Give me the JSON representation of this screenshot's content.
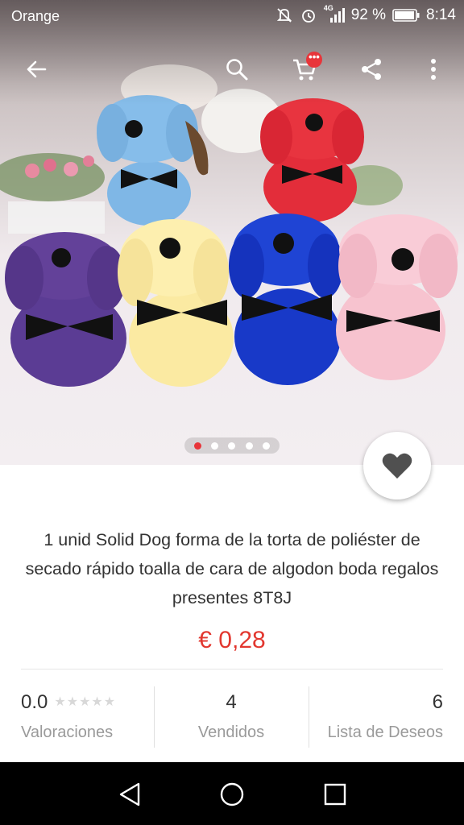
{
  "status_bar": {
    "carrier": "Orange",
    "network": "4G",
    "battery_percent": "92 %",
    "time": "8:14"
  },
  "toolbar": {
    "icons": [
      "back-arrow-icon",
      "search-icon",
      "cart-icon",
      "share-icon",
      "more-vert-icon"
    ],
    "cart_badge": "•••"
  },
  "gallery": {
    "image_count": 5,
    "active_index": 0
  },
  "product": {
    "title": "1 unid Solid Dog forma de la torta de poliéster de secado rápido toalla de cara de algodon boda regalos presentes 8T8J",
    "price": "€ 0,28"
  },
  "stats": {
    "rating_value": "0.0",
    "rating_stars": "★★★★★",
    "rating_label": "Valoraciones",
    "sold_value": "4",
    "sold_label": "Vendidos",
    "wishlist_value": "6",
    "wishlist_label": "Lista de Deseos"
  },
  "colors": {
    "accent": "#e8353a",
    "price": "#e2372f",
    "nav_bar": "#000000"
  }
}
